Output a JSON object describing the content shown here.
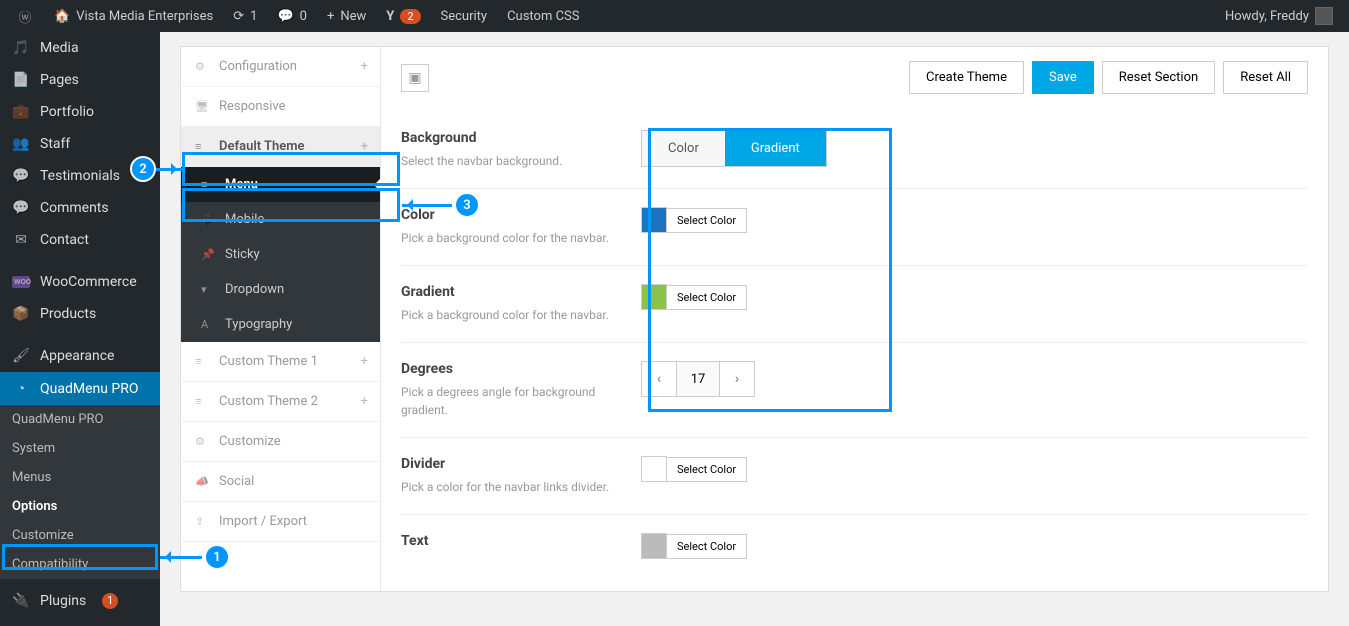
{
  "adminbar": {
    "site_name": "Vista Media Enterprises",
    "updates_count": "1",
    "comments_count": "0",
    "new_label": "New",
    "yoast_badge": "2",
    "security_label": "Security",
    "custom_css_label": "Custom CSS",
    "howdy": "Howdy, Freddy"
  },
  "sidebar": {
    "items": {
      "media": "Media",
      "pages": "Pages",
      "portfolio": "Portfolio",
      "staff": "Staff",
      "testimonials": "Testimonials",
      "comments": "Comments",
      "contact": "Contact",
      "woocommerce": "WooCommerce",
      "products": "Products",
      "appearance": "Appearance",
      "quadmenu": "QuadMenu PRO",
      "plugins": "Plugins"
    },
    "submenu": {
      "quadmenu_pro": "QuadMenu PRO",
      "system": "System",
      "menus": "Menus",
      "options": "Options",
      "customize": "Customize",
      "compatibility": "Compatibility"
    },
    "plugins_count": "1"
  },
  "opt_sidebar": {
    "configuration": "Configuration",
    "responsive": "Responsive",
    "default_theme": "Default Theme",
    "menu": "Menu",
    "mobile": "Mobile",
    "sticky": "Sticky",
    "dropdown": "Dropdown",
    "typography": "Typography",
    "custom_theme_1": "Custom Theme 1",
    "custom_theme_2": "Custom Theme 2",
    "customize": "Customize",
    "social": "Social",
    "import_export": "Import / Export"
  },
  "top_buttons": {
    "create_theme": "Create Theme",
    "save": "Save",
    "reset_section": "Reset Section",
    "reset_all": "Reset All"
  },
  "fields": {
    "background": {
      "title": "Background",
      "desc": "Select the navbar background.",
      "opt_color": "Color",
      "opt_gradient": "Gradient"
    },
    "color": {
      "title": "Color",
      "desc": "Pick a background color for the navbar.",
      "btn": "Select Color"
    },
    "gradient": {
      "title": "Gradient",
      "desc": "Pick a background color for the navbar.",
      "btn": "Select Color"
    },
    "degrees": {
      "title": "Degrees",
      "desc": "Pick a degrees angle for background gradient.",
      "value": "17"
    },
    "divider": {
      "title": "Divider",
      "desc": "Pick a color for the navbar links divider.",
      "btn": "Select Color"
    },
    "text": {
      "title": "Text",
      "btn": "Select Color"
    }
  },
  "annotations": {
    "n1": "1",
    "n2": "2",
    "n3": "3"
  }
}
